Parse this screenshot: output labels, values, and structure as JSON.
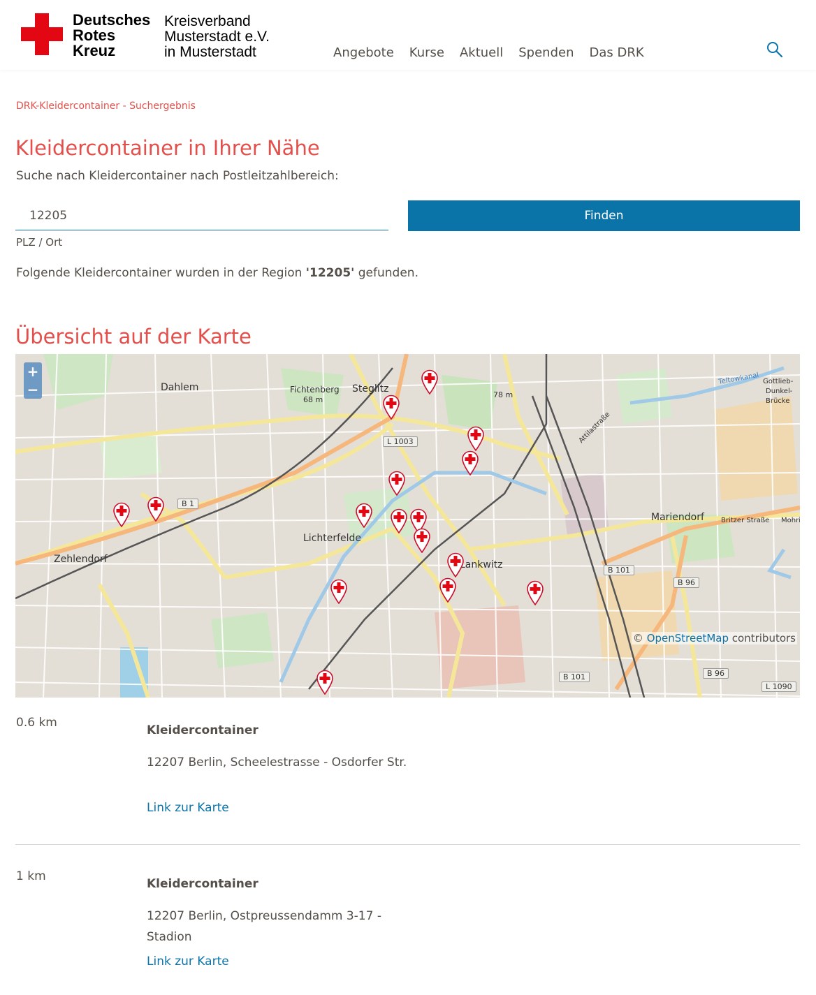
{
  "header": {
    "logo_lines": [
      "Deutsches",
      "Rotes",
      "Kreuz"
    ],
    "org_lines": [
      "Kreisverband",
      "Musterstadt e.V.",
      "in Musterstadt"
    ],
    "nav": [
      "Angebote",
      "Kurse",
      "Aktuell",
      "Spenden",
      "Das DRK"
    ],
    "search_icon": "search-icon",
    "brand_color": "#e30613"
  },
  "breadcrumb": "DRK-Kleidercontainer - Suchergebnis",
  "title": "Kleidercontainer in Ihrer Nähe",
  "intro": "Suche nach Kleidercontainer nach Postleitzahlbereich:",
  "search": {
    "value": "12205",
    "label": "PLZ / Ort",
    "button": "Finden"
  },
  "result_sentence": {
    "before": "Folgende Kleidercontainer wurden in der Region ",
    "region": "'12205'",
    "after": " gefunden."
  },
  "map_heading": "Übersicht auf der Karte",
  "map": {
    "zoom_in": "+",
    "zoom_out": "−",
    "attribution_prefix": "© ",
    "attribution_link": "OpenStreetMap",
    "attribution_suffix": " contributors",
    "labels": [
      "Dahlem",
      "Steglitz",
      "Fichtenberg",
      "68 m",
      "78 m",
      "Lichterfelde",
      "Zehlendorf",
      "Mariendorf",
      "Lankwitz",
      "Gottlieb-",
      "Dunkel-",
      "Brücke",
      "Teltowkanal",
      "Attilastraße",
      "Britzer Straße",
      "Mohrin"
    ],
    "road_badges": [
      "L 1003",
      "B 1",
      "B 101",
      "B 96",
      "B 101",
      "B 96",
      "L 1090"
    ],
    "marker_count": 19
  },
  "results": [
    {
      "distance": "0.6 km",
      "title": "Kleidercontainer",
      "address": "12207 Berlin, Scheelestrasse - Osdorfer Str.",
      "link": "Link zur Karte"
    },
    {
      "distance": "1 km",
      "title": "Kleidercontainer",
      "address": "12207 Berlin, Ostpreussendamm 3-17 - Stadion",
      "link": "Link zur Karte"
    }
  ]
}
